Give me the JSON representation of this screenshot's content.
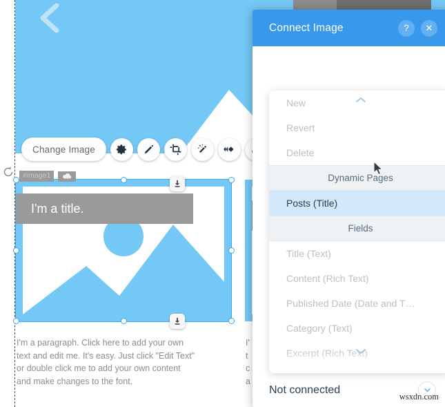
{
  "canvas": {
    "back_arrow_icon": "chevron-left-icon",
    "rotate_handle_icon": "rotate-icon",
    "component_tag": {
      "name": "#image1",
      "icon": "cloud-icon"
    },
    "toolbar": {
      "change_image_label": "Change Image",
      "buttons": [
        {
          "icon": "gear-icon",
          "name": "settings"
        },
        {
          "icon": "pencil-icon",
          "name": "design"
        },
        {
          "icon": "crop-icon",
          "name": "crop"
        },
        {
          "icon": "magic-wand-icon",
          "name": "effects"
        },
        {
          "icon": "animation-icon",
          "name": "animation"
        },
        {
          "icon": "link-icon",
          "name": "link"
        }
      ]
    },
    "image_element": {
      "title_text": "I'm a title.",
      "placeholder_icon": "image-placeholder-icon",
      "download_badge_icon": "download-icon"
    },
    "paragraph_column_1": [
      "I'm a paragraph. Click here to add your own",
      "text and edit me. It's easy. Just click \"Edit Text\"",
      "or double click me to add your own content",
      "and make changes to the font."
    ],
    "paragraph_column_2": [
      "I'",
      "t",
      "c",
      "a"
    ]
  },
  "dialog": {
    "title": "Connect Image",
    "help_label": "?",
    "close_label": "✕",
    "help_icon": "question-mark-icon",
    "close_icon": "close-icon",
    "connection": {
      "label": "Not connected",
      "caret_icon": "chevron-down-icon"
    }
  },
  "dropdown": {
    "scroll_up_icon": "chevron-up-icon",
    "scroll_down_icon": "chevron-down-icon",
    "items": [
      {
        "label": "New",
        "state": "disabled"
      },
      {
        "label": "Revert",
        "state": "disabled"
      },
      {
        "label": "Delete",
        "state": "disabled"
      },
      {
        "label": "Dynamic Pages",
        "state": "header"
      },
      {
        "label": "Posts (Title)",
        "state": "selected"
      },
      {
        "label": "Fields",
        "state": "header"
      },
      {
        "label": "Title (Text)",
        "state": "disabled"
      },
      {
        "label": "Content (Rich Text)",
        "state": "disabled"
      },
      {
        "label": "Published Date (Date and T…",
        "state": "disabled"
      },
      {
        "label": "Category (Text)",
        "state": "disabled"
      },
      {
        "label": "Excerpt (Rich Text)",
        "state": "disabled"
      }
    ]
  },
  "watermark": "wsxdn.com",
  "colors": {
    "accent_blue": "#3899ec",
    "image_blue": "#74c8f5",
    "selected_row": "#d3e9fb",
    "header_row": "#eef2f5",
    "band_gray": "#9a9a9a"
  }
}
